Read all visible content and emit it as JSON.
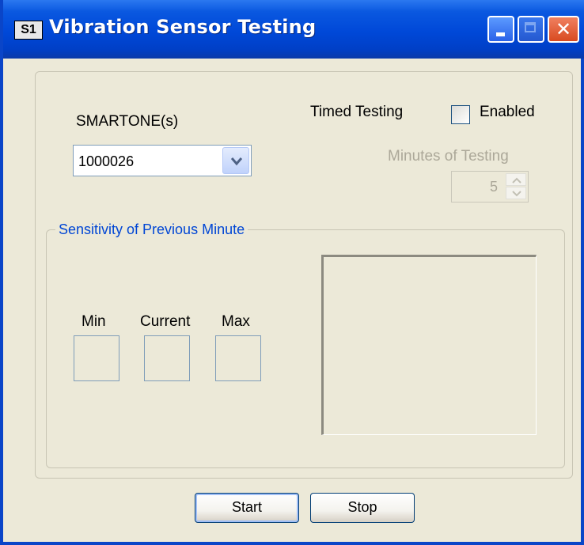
{
  "window": {
    "app_icon_text": "S1",
    "title": "Vibration Sensor Testing",
    "colors": {
      "titlebar": "#0048d8",
      "face": "#ece9d8",
      "group_title": "#0046d5",
      "disabled_text": "#aca899"
    }
  },
  "smartone": {
    "label": "SMARTONE(s)",
    "selected": "1000026",
    "dropdown_icon": "chevron-down-icon"
  },
  "timed_testing": {
    "label": "Timed Testing",
    "enabled_label": "Enabled",
    "enabled_checked": false,
    "minutes_label": "Minutes of Testing",
    "minutes_value": "5",
    "minutes_enabled": false
  },
  "sensitivity": {
    "group_title": "Sensitivity of Previous Minute",
    "min_label": "Min",
    "current_label": "Current",
    "max_label": "Max",
    "min_value": "",
    "current_value": "",
    "max_value": ""
  },
  "buttons": {
    "start": "Start",
    "stop": "Stop"
  }
}
